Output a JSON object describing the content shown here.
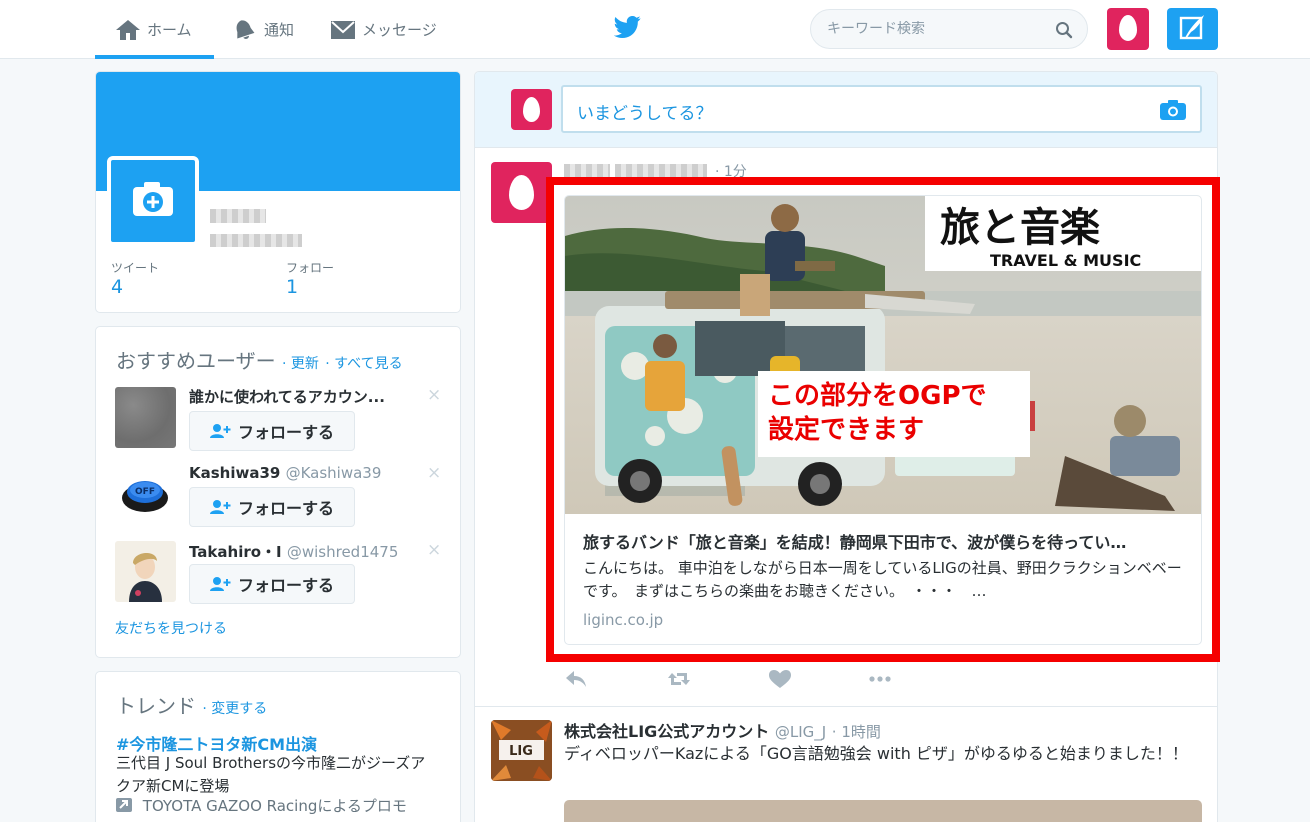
{
  "nav": {
    "home": "ホーム",
    "notifications": "通知",
    "messages": "メッセージ",
    "search_placeholder": "キーワード検索"
  },
  "colors": {
    "brand": "#1da1f2",
    "egg_avatar": "#e0245e",
    "highlight": "#f50000"
  },
  "profile": {
    "tweets_label": "ツイート",
    "tweets_count": "4",
    "following_label": "フォロー",
    "following_count": "1"
  },
  "who_to_follow": {
    "title": "おすすめユーザー",
    "refresh": "· 更新",
    "view_all": "· すべて見る",
    "follow_label": "フォローする",
    "find_friends": "友だちを見つける",
    "users": [
      {
        "name": "誰かに使われてるアカウン...",
        "handle": "",
        "close": "×",
        "image_icon": "gray-texture"
      },
      {
        "name": "Kashiwa39",
        "handle": "@Kashiwa39",
        "close": "×",
        "image_icon": "off-button-icon"
      },
      {
        "name": "Takahiro・I",
        "handle": "@wishred1475",
        "close": "×",
        "image_icon": "illustrated-person"
      }
    ]
  },
  "trends": {
    "title": "トレンド",
    "change": "· 変更する",
    "items": [
      {
        "tag": "#今市隆二トヨタ新CM出演",
        "desc": "三代目 J Soul Brothersの今市隆二がジーズアクア新CMに登場",
        "promo": "TOYOTA GAZOO Racingによるプロモ"
      }
    ]
  },
  "composer": {
    "placeholder": "いまどうしてる？"
  },
  "tweet1": {
    "time": "· 1分",
    "card": {
      "logo_title": "旅と音楽",
      "logo_sub": "TRAVEL & MUSIC",
      "title": "旅するバンド「旅と音楽」を結成！静岡県下田市で、波が僕らを待ってい…",
      "description": "こんにちは。 車中泊をしながら日本一周をしているLIGの社員、野田クラクションベベーです。　まずはこちらの楽曲をお聴きください。　・・・　…",
      "domain": "liginc.co.jp"
    }
  },
  "callout": {
    "line1": "この部分をOGPで",
    "line2": "設定できます"
  },
  "tweet2": {
    "name": "株式会社LIG公式アカウント",
    "handle": "@LIG_J",
    "time": "· 1時間",
    "text": "ディベロッパーKazによる「GO言語勉強会 with ピザ」がゆるゆると始まりました！！",
    "avatar_text": "LIG"
  }
}
